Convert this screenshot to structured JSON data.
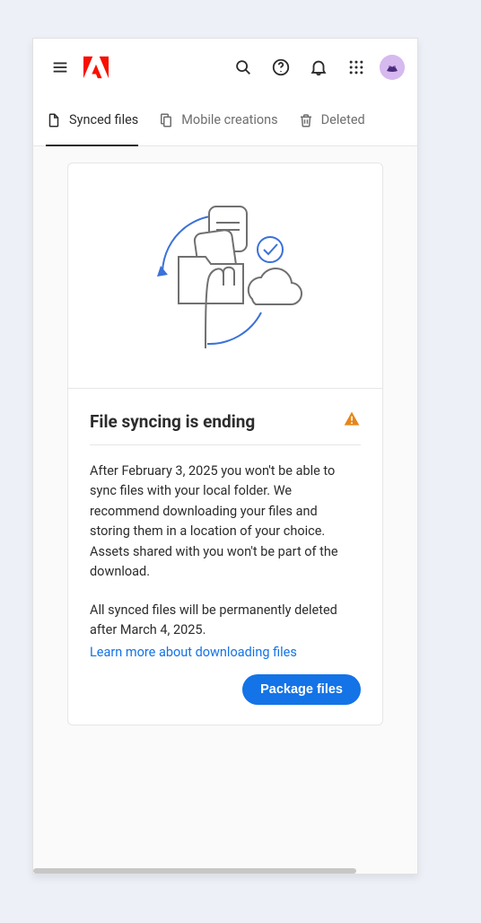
{
  "tabs": {
    "synced": "Synced files",
    "mobile": "Mobile creations",
    "deleted": "Deleted"
  },
  "notice": {
    "title": "File syncing is ending",
    "para1": "After February 3, 2025 you won't be able to sync files with your local folder. We recommend downloading your files and storing them in a location of your choice. Assets shared with you won't be part of the download.",
    "para2": "All synced files will be permanently deleted after March 4, 2025.",
    "learn_more": "Learn more about downloading files",
    "cta": "Package files"
  }
}
